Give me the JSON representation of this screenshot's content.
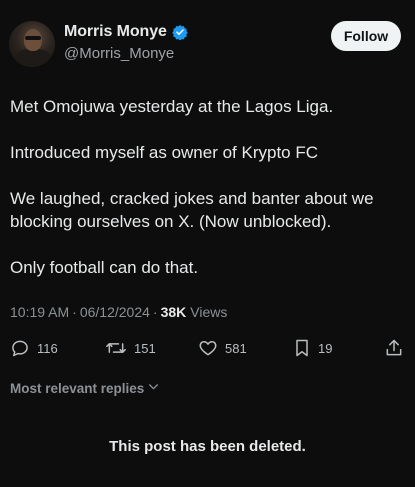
{
  "author": {
    "display_name": "Morris Monye",
    "handle": "@Morris_Monye",
    "verified": true,
    "verified_color": "#1d9bf0"
  },
  "follow_label": "Follow",
  "tweet": {
    "paragraphs": [
      "Met Omojuwa yesterday at the Lagos Liga.",
      "Introduced myself as owner of Krypto FC",
      "We laughed, cracked jokes and banter about we blocking ourselves on X. (Now unblocked).",
      "Only football can do that."
    ]
  },
  "meta": {
    "time": "10:19 AM",
    "separator": "·",
    "date": "06/12/2024",
    "views_count": "38K",
    "views_label": "Views"
  },
  "actions": {
    "replies": "116",
    "reposts": "151",
    "likes": "581",
    "bookmarks": "19"
  },
  "replies_filter": {
    "label": "Most relevant replies"
  },
  "deleted_notice": "This post has been deleted.",
  "icons": {
    "reply": "reply-icon",
    "repost": "repost-icon",
    "like": "heart-icon",
    "bookmark": "bookmark-icon",
    "share": "share-icon",
    "verified": "verified-badge-icon",
    "chevron": "chevron-down-icon"
  }
}
